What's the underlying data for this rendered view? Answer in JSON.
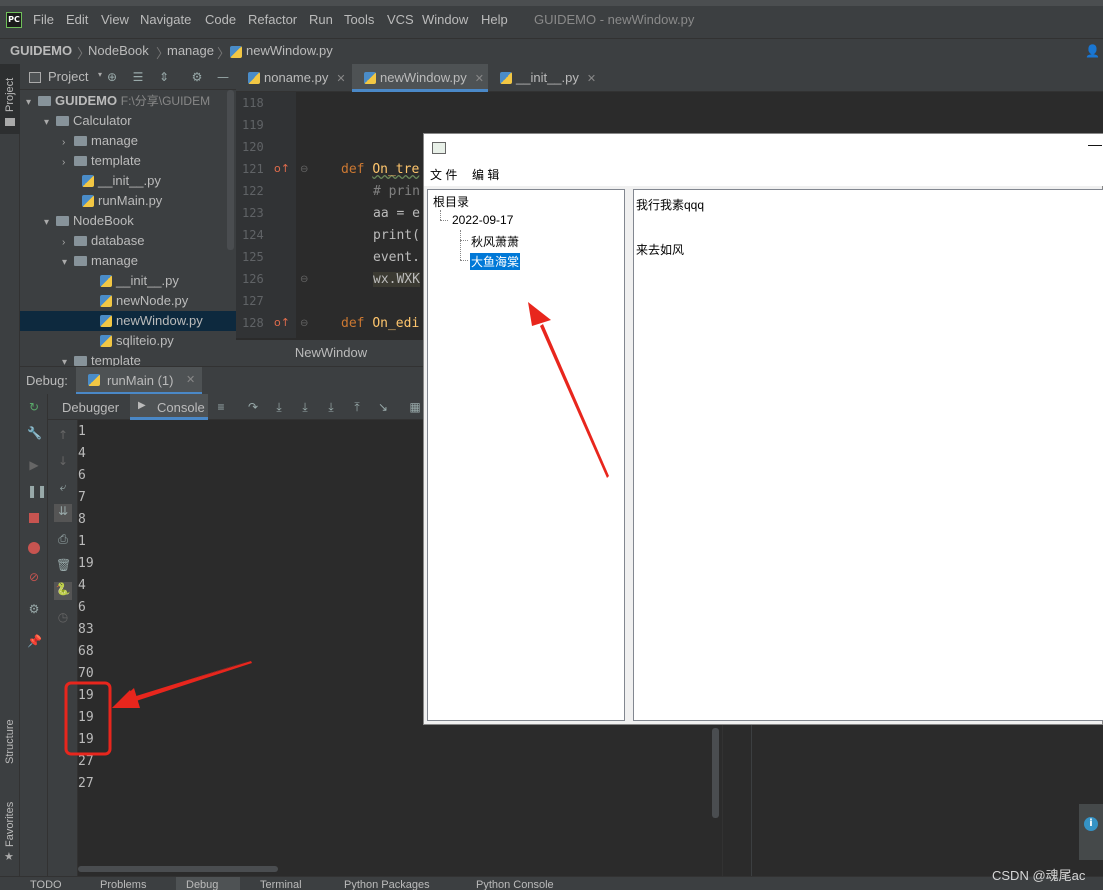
{
  "app": {
    "menu": [
      "File",
      "Edit",
      "View",
      "Navigate",
      "Code",
      "Refactor",
      "Run",
      "Tools",
      "VCS",
      "Window",
      "Help"
    ],
    "window_title": "GUIDEMO - newWindow.py"
  },
  "breadcrumb": [
    "GUIDEMO",
    "NodeBook",
    "manage",
    "newWindow.py"
  ],
  "side_tabs": {
    "project": "Project",
    "structure": "Structure",
    "favorites": "Favorites"
  },
  "project_panel": {
    "header": "Project",
    "tree": [
      {
        "label": "GUIDEMO",
        "extra": "F:\\分享\\GUIDEM",
        "kind": "root",
        "depth": 0
      },
      {
        "label": "Calculator",
        "kind": "folder",
        "depth": 1
      },
      {
        "label": "manage",
        "kind": "folder",
        "depth": 2
      },
      {
        "label": "template",
        "kind": "folder",
        "depth": 2
      },
      {
        "label": "__init__.py",
        "kind": "file",
        "depth": 2
      },
      {
        "label": "runMain.py",
        "kind": "file",
        "depth": 2
      },
      {
        "label": "NodeBook",
        "kind": "folder",
        "depth": 1
      },
      {
        "label": "database",
        "kind": "folder",
        "depth": 2
      },
      {
        "label": "manage",
        "kind": "folder",
        "depth": 2
      },
      {
        "label": "__init__.py",
        "kind": "file",
        "depth": 3
      },
      {
        "label": "newNode.py",
        "kind": "file",
        "depth": 3
      },
      {
        "label": "newWindow.py",
        "kind": "file",
        "depth": 3,
        "selected": true
      },
      {
        "label": "sqliteio.py",
        "kind": "file",
        "depth": 3
      },
      {
        "label": "template",
        "kind": "folder",
        "depth": 2
      }
    ]
  },
  "editor_tabs": [
    {
      "label": "noname.py"
    },
    {
      "label": "newWindow.py",
      "active": true
    },
    {
      "label": "__init__.py"
    }
  ],
  "editor": {
    "line_numbers": [
      "118",
      "119",
      "120",
      "121",
      "122",
      "123",
      "124",
      "125",
      "126",
      "127",
      "128"
    ],
    "code": {
      "l121_kw": "def ",
      "l121_fn": "On_tre",
      "l122": "# prin",
      "l123": "aa = e",
      "l124": "print(",
      "l125": "event.",
      "l126": "wx.WXK",
      "l128_kw": "def ",
      "l128_fn": "On_edi"
    }
  },
  "new_window_tab": "NewWindow",
  "debug": {
    "label": "Debug:",
    "config": "runMain (1)",
    "tabs": [
      "Debugger",
      "Console"
    ],
    "console_lines": [
      "1",
      "4",
      "6",
      "7",
      "8",
      "1",
      "19",
      "4",
      "6",
      "83",
      "68",
      "70",
      "19",
      "19",
      "19",
      "27",
      "27"
    ]
  },
  "app_window": {
    "menu": [
      "文 件",
      "编 辑"
    ],
    "tree": {
      "root": "根目录",
      "date": "2022-09-17",
      "child1": "秋风萧萧",
      "child2": "大鱼海棠"
    },
    "content_lines": [
      "我行我素qqq",
      "来去如风"
    ]
  },
  "status_bar": [
    "TODO",
    "Problems",
    "Debug",
    "Terminal",
    "Python Packages",
    "Python Console"
  ],
  "watermark": "CSDN @魂尾ac",
  "colors": {
    "accent": "#4a88c7",
    "annotation_red": "#e8261d",
    "selection": "#0078d7"
  }
}
